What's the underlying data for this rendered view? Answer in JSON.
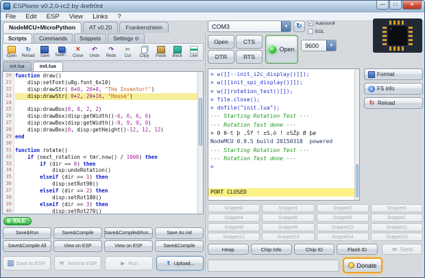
{
  "window": {
    "title": "ESPlorer v0.2.0-rc2 by 4refr0nt",
    "controls": {
      "minimize": "—",
      "maximize": "□",
      "close": "×"
    },
    "menu": [
      "File",
      "Edit",
      "ESP",
      "View",
      "Links",
      "?"
    ]
  },
  "firmware_tabs": [
    "NodeMCU+MicroPython",
    "AT v0.20",
    "Frankenshtein"
  ],
  "left": {
    "tabs": [
      {
        "label": "Scripts"
      },
      {
        "label": "Commands"
      },
      {
        "label": "Snippets"
      },
      {
        "label": "Settings",
        "icon": "gear-icon"
      }
    ],
    "toolbar": [
      {
        "label": "Open",
        "icon": "folder-icon"
      },
      {
        "label": "Reload",
        "icon": "reload-icon"
      },
      {
        "label": "Save",
        "icon": "save-icon"
      },
      {
        "label": "Save...",
        "icon": "save-as-icon"
      },
      {
        "label": "Close",
        "icon": "close-file-icon"
      },
      {
        "label": "Undo",
        "icon": "undo-icon"
      },
      {
        "label": "Redo",
        "icon": "redo-icon"
      },
      {
        "label": "Cut",
        "icon": "cut-icon"
      },
      {
        "label": "Copy",
        "icon": "copy-icon"
      },
      {
        "label": "Paste",
        "icon": "paste-icon"
      },
      {
        "label": "Block",
        "icon": "block-comment-icon"
      },
      {
        "label": "Line",
        "icon": "line-comment-icon"
      }
    ],
    "file_tabs": [
      "init.lua",
      "init.lua"
    ],
    "status": "IDLE",
    "editor": {
      "highlight_index": 3,
      "lines": [
        {
          "n": "20",
          "seg": [
            [
              "kw",
              "function"
            ],
            [
              "pl",
              " draw()"
            ]
          ]
        },
        {
          "n": "21",
          "seg": [
            [
              "pl",
              "    disp:setFont(u8g.font_6x10)"
            ]
          ]
        },
        {
          "n": "22",
          "seg": [
            [
              "pl",
              "    disp:drawStr( "
            ],
            [
              "num",
              "0"
            ],
            [
              "pl",
              "+"
            ],
            [
              "num",
              "0"
            ],
            [
              "pl",
              ", "
            ],
            [
              "num",
              "20"
            ],
            [
              "pl",
              "+"
            ],
            [
              "num",
              "0"
            ],
            [
              "pl",
              ", "
            ],
            [
              "str",
              "\"The Inventor!\""
            ],
            [
              "pl",
              ")"
            ]
          ]
        },
        {
          "n": "23",
          "seg": [
            [
              "pl",
              "    disp:drawStr( "
            ],
            [
              "num",
              "0"
            ],
            [
              "pl",
              "+"
            ],
            [
              "num",
              "2"
            ],
            [
              "pl",
              ", "
            ],
            [
              "num",
              "20"
            ],
            [
              "pl",
              "+"
            ],
            [
              "num",
              "16"
            ],
            [
              "pl",
              ", "
            ],
            [
              "str",
              "\"House\""
            ],
            [
              "pl",
              ")"
            ]
          ]
        },
        {
          "n": "24",
          "seg": []
        },
        {
          "n": "25",
          "seg": [
            [
              "pl",
              "    disp:drawBox("
            ],
            [
              "num",
              "0"
            ],
            [
              "pl",
              ", "
            ],
            [
              "num",
              "0"
            ],
            [
              "pl",
              ", "
            ],
            [
              "num",
              "2"
            ],
            [
              "pl",
              ", "
            ],
            [
              "num",
              "2"
            ],
            [
              "pl",
              ")"
            ]
          ]
        },
        {
          "n": "26",
          "seg": [
            [
              "pl",
              "    disp:drawBox(disp:getWidth()-"
            ],
            [
              "num",
              "6"
            ],
            [
              "pl",
              ", "
            ],
            [
              "num",
              "0"
            ],
            [
              "pl",
              ", "
            ],
            [
              "num",
              "6"
            ],
            [
              "pl",
              ", "
            ],
            [
              "num",
              "6"
            ],
            [
              "pl",
              ")"
            ]
          ]
        },
        {
          "n": "27",
          "seg": [
            [
              "pl",
              "    disp:drawBox(disp:getWidth()-"
            ],
            [
              "num",
              "9"
            ],
            [
              "pl",
              ", "
            ],
            [
              "num",
              "9"
            ],
            [
              "pl",
              ", "
            ],
            [
              "num",
              "9"
            ],
            [
              "pl",
              ", "
            ],
            [
              "num",
              "9"
            ],
            [
              "pl",
              ")"
            ]
          ]
        },
        {
          "n": "28",
          "seg": [
            [
              "pl",
              "    disp:drawBox("
            ],
            [
              "num",
              "0"
            ],
            [
              "pl",
              ", disp:getHeight()-"
            ],
            [
              "num",
              "12"
            ],
            [
              "pl",
              ", "
            ],
            [
              "num",
              "12"
            ],
            [
              "pl",
              ", "
            ],
            [
              "num",
              "12"
            ],
            [
              "pl",
              ")"
            ]
          ]
        },
        {
          "n": "29",
          "seg": [
            [
              "kw",
              "end"
            ]
          ]
        },
        {
          "n": "30",
          "seg": []
        },
        {
          "n": "31",
          "seg": [
            [
              "kw",
              "function"
            ],
            [
              "pl",
              " rotate()"
            ]
          ]
        },
        {
          "n": "32",
          "seg": [
            [
              "pl",
              "    "
            ],
            [
              "kw",
              "if"
            ],
            [
              "pl",
              " (next_rotation < tmr.now() / "
            ],
            [
              "num",
              "1000"
            ],
            [
              "pl",
              ") "
            ],
            [
              "kw",
              "then"
            ]
          ]
        },
        {
          "n": "33",
          "seg": [
            [
              "pl",
              "        "
            ],
            [
              "kw",
              "if"
            ],
            [
              "pl",
              " (dir == "
            ],
            [
              "num",
              "0"
            ],
            [
              "pl",
              ") "
            ],
            [
              "kw",
              "then"
            ]
          ]
        },
        {
          "n": "34",
          "seg": [
            [
              "pl",
              "            disp:undoRotation()"
            ]
          ]
        },
        {
          "n": "35",
          "seg": [
            [
              "pl",
              "        "
            ],
            [
              "kw",
              "elseif"
            ],
            [
              "pl",
              " (dir == "
            ],
            [
              "num",
              "1"
            ],
            [
              "pl",
              ") "
            ],
            [
              "kw",
              "then"
            ]
          ]
        },
        {
          "n": "36",
          "seg": [
            [
              "pl",
              "            disp:setRot90()"
            ]
          ]
        },
        {
          "n": "37",
          "seg": [
            [
              "pl",
              "        "
            ],
            [
              "kw",
              "elseif"
            ],
            [
              "pl",
              " (dir == "
            ],
            [
              "num",
              "2"
            ],
            [
              "pl",
              ") "
            ],
            [
              "kw",
              "then"
            ]
          ]
        },
        {
          "n": "38",
          "seg": [
            [
              "pl",
              "            disp:setRot180()"
            ]
          ]
        },
        {
          "n": "39",
          "seg": [
            [
              "pl",
              "        "
            ],
            [
              "kw",
              "elseif"
            ],
            [
              "pl",
              " (dir == "
            ],
            [
              "num",
              "3"
            ],
            [
              "pl",
              ") "
            ],
            [
              "kw",
              "then"
            ]
          ]
        },
        {
          "n": "40",
          "seg": [
            [
              "pl",
              "            disp:setRot270()"
            ]
          ]
        }
      ]
    },
    "action_rows": [
      [
        "Save&Run",
        "Save&Compile",
        "Save&Compile&Run...",
        "Save As init"
      ],
      [
        "Save&Compile All",
        "View on ESP",
        "View on ESP",
        "Save&Compile"
      ]
    ],
    "bottom_buttons": [
      {
        "label": "Save to ESP",
        "icon": "save-icon",
        "enabled": false
      },
      {
        "label": "Send to ESP",
        "icon": "send-icon",
        "enabled": false
      },
      {
        "label": "Run",
        "icon": "play-icon",
        "enabled": false
      },
      {
        "label": "Upload...",
        "icon": "upload-icon",
        "enabled": true
      }
    ]
  },
  "right": {
    "port": "COM3",
    "baud": "9600",
    "port_buttons": [
      "Open",
      "CTS",
      "DTR",
      "RTS"
    ],
    "open_toggle": "Open",
    "checkboxes": [
      {
        "label": "Autoscroll",
        "checked": true
      },
      {
        "label": "EOL",
        "checked": false
      }
    ],
    "terminal": [
      {
        "c": "cmd",
        "t": "> w([[--init_i2c_display()]]);"
      },
      {
        "c": "cmd",
        "t": "> w([[init_spi_display()]]);"
      },
      {
        "c": "cmd",
        "t": "> w([[rotation_test()]]);"
      },
      {
        "c": "cmd",
        "t": "> file.close();"
      },
      {
        "c": "cmd",
        "t": "> dofile(\"init.lua\");"
      },
      {
        "c": "sys",
        "t": "--- Starting Rotation Test ---"
      },
      {
        "c": "sys",
        "t": "--- Rotation Test done ---"
      },
      {
        "c": "raw",
        "t": "> 0 θ-t þ ‚Šf ! ±S‚ò ! ±SŽp Ø þø"
      },
      {
        "c": "info",
        "t": "NodeMCU 0.9.5 build 20150318  powered"
      },
      {
        "c": "sys",
        "t": "--- Starting Rotation Test ---"
      },
      {
        "c": "sys",
        "t": "--- Rotation Test done ---"
      },
      {
        "c": "cmd",
        "t": ">"
      },
      {
        "c": "plain",
        "t": ""
      },
      {
        "c": "plain",
        "t": ""
      },
      {
        "c": "hl",
        "t": "PORT CLOSED"
      }
    ],
    "side_buttons": [
      {
        "label": "Format",
        "icon": "format-icon"
      },
      {
        "label": "FS info",
        "icon": "fsinfo-icon"
      },
      {
        "label": "Reload",
        "icon": "reload-icon"
      }
    ],
    "snippets": [
      "Snippet0",
      "Snippet1",
      "Snippet2",
      "Snippet3",
      "Snippet4",
      "Snippet5",
      "Snippet6",
      "Snippet7",
      "Snippet8",
      "Snippet9",
      "Snippet10",
      "Snippet11",
      "Snippet12",
      "Snippet13",
      "Snippet14",
      "Snippet15"
    ],
    "command_buttons": [
      "Heap",
      "Chip Info",
      "Chip ID",
      "Flash ID"
    ],
    "send_label": "Send",
    "command_input": "",
    "donate_label": "Donate"
  }
}
